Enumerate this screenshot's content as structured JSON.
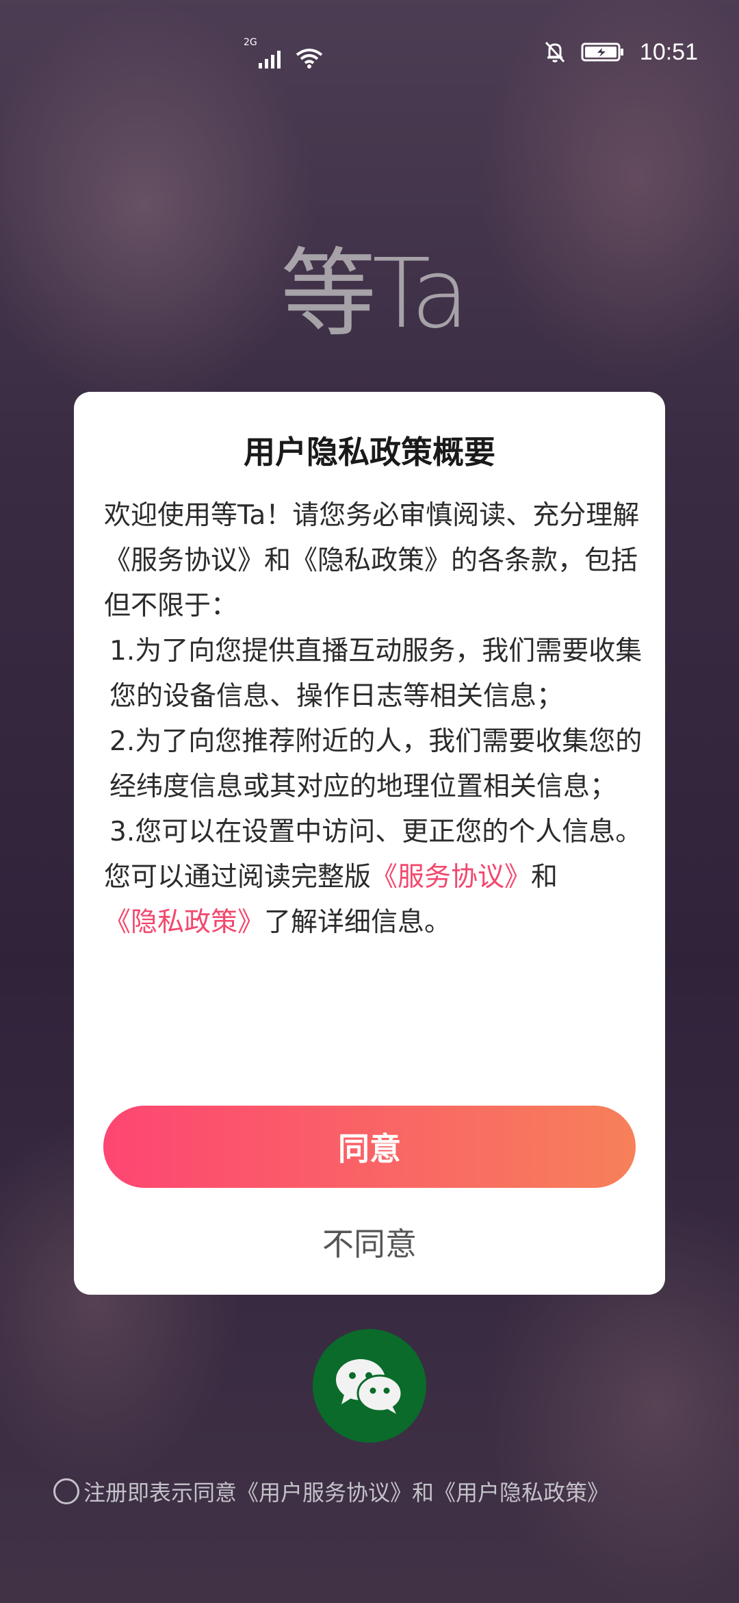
{
  "status_bar": {
    "network_type": "2G",
    "time": "10:51",
    "icons": [
      "signal-icon",
      "wifi-icon",
      "notifications-off-icon",
      "battery-charging-icon"
    ]
  },
  "app": {
    "logo_text": "等Ta"
  },
  "dialog": {
    "title": "用户隐私政策概要",
    "intro": "欢迎使用等Ta！请您务必审慎阅读、充分理解《服务协议》和《隐私政策》的各条款，包括但不限于：",
    "items": [
      "1.为了向您提供直播互动服务，我们需要收集您的设备信息、操作日志等相关信息；",
      "2.为了向您推荐附近的人，我们需要收集您的经纬度信息或其对应的地理位置相关信息；",
      "3.您可以在设置中访问、更正您的个人信息。"
    ],
    "closing_prefix": "您可以通过阅读完整版",
    "service_link": "《服务协议》",
    "closing_and": "和",
    "privacy_link": "《隐私政策》",
    "closing_suffix": "了解详细信息。",
    "agree_label": "同意",
    "disagree_label": "不同意"
  },
  "login": {
    "wechat_icon": "wechat-icon"
  },
  "footer": {
    "agreement_text": "注册即表示同意《用户服务协议》和《用户隐私政策》"
  },
  "colors": {
    "accent_start": "#fd4672",
    "accent_end": "#f7805a",
    "link": "#f2486e",
    "wechat_green": "#0a6b2a"
  }
}
